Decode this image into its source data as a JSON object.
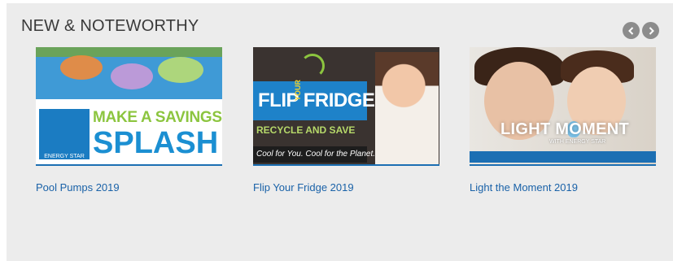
{
  "section": {
    "title": "NEW & NOTEWORTHY"
  },
  "nav": {
    "prev_icon": "chevron-left-icon",
    "next_icon": "chevron-right-icon"
  },
  "cards": [
    {
      "caption": "Pool Pumps 2019",
      "image": {
        "line1": "MAKE A SAVINGS",
        "line2": "SPLASH",
        "badge": "ENERGY STAR"
      }
    },
    {
      "caption": "Flip Your Fridge 2019",
      "image": {
        "headline": "FLIP  FRIDGE",
        "small": "YOUR",
        "line2": "RECYCLE AND SAVE",
        "tagline": "Cool for You. Cool for the Planet."
      }
    },
    {
      "caption": "Light the Moment 2019",
      "image": {
        "headline": "LIGHT  MOMENT",
        "sub": "WITH ENERGY STAR"
      }
    }
  ],
  "colors": {
    "panel": "#ececec",
    "link": "#1a62a8",
    "accent": "#1c6fb3"
  }
}
